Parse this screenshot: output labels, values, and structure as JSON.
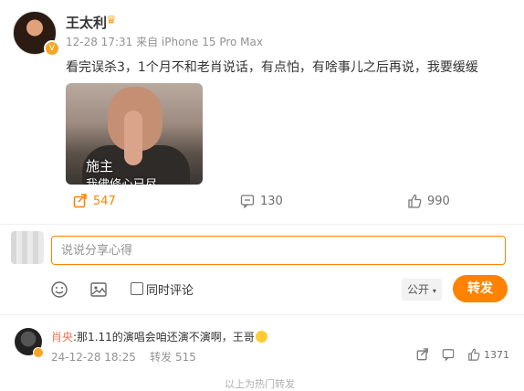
{
  "post": {
    "author": "王太利",
    "timestamp": "12-28 17:31",
    "source": "来自 iPhone 15 Pro Max",
    "text": "看完误杀3，1个月不和老肖说话，有点怕，有啥事儿之后再说，我要缓缓",
    "image_caption_line1": "施主",
    "image_caption_line2": "我佛修心已尽"
  },
  "actions": {
    "repost_count": "547",
    "comment_count": "130",
    "like_count": "990"
  },
  "composer": {
    "placeholder": "说说分享心得",
    "also_comment_label": "同时评论",
    "visibility_label": "公开",
    "send_label": "转发"
  },
  "comment": {
    "name": "肖央",
    "text": ":那1.11的演唱会咱还演不演啊，王哥",
    "timestamp": "24-12-28 18:25",
    "repost_label": "转发 515",
    "like_count": "1371"
  },
  "footer": {
    "text": "以上为热门转发"
  },
  "colors": {
    "accent": "#ff8200",
    "name_link": "#eb7350",
    "muted": "#939393"
  },
  "icons": [
    "crown-icon",
    "verify-badge-icon",
    "repost-icon",
    "comment-icon",
    "like-icon",
    "emoji-icon",
    "image-icon",
    "chevron-down-icon",
    "share-icon"
  ]
}
